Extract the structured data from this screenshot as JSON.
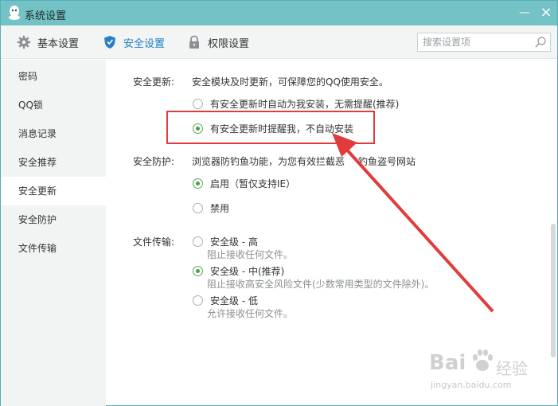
{
  "window": {
    "title": "系统设置",
    "minimize": "—",
    "close": "×"
  },
  "toolbar": {
    "tabs": [
      {
        "label": "基本设置",
        "icon": "gear-icon"
      },
      {
        "label": "安全设置",
        "icon": "shield-icon",
        "active": true
      },
      {
        "label": "权限设置",
        "icon": "lock-icon"
      }
    ],
    "search_placeholder": "搜索设置项"
  },
  "sidebar": {
    "items": [
      {
        "label": "密码"
      },
      {
        "label": "QQ锁"
      },
      {
        "label": "消息记录"
      },
      {
        "label": "安全推荐"
      },
      {
        "label": "安全更新",
        "active": true
      },
      {
        "label": "安全防护"
      },
      {
        "label": "文件传输"
      }
    ]
  },
  "content": {
    "update": {
      "label": "安全更新:",
      "desc": "安全模块及时更新，可保障您的QQ使用安全。",
      "options": [
        {
          "label": "有安全更新时自动为我安装，无需提醒(推荐)",
          "checked": false
        },
        {
          "label": "有安全更新时提醒我，不自动安装",
          "checked": true
        }
      ]
    },
    "protect": {
      "label": "安全防护:",
      "desc": "浏览器防钓鱼功能，为您有效拦截恶",
      "desc_tail": "钓鱼盗号网站",
      "options": [
        {
          "label": "启用（暂仅支持IE）",
          "checked": true
        },
        {
          "label": "禁用",
          "checked": false
        }
      ]
    },
    "transfer": {
      "label": "文件传输:",
      "options": [
        {
          "label": "安全级 - 高",
          "sub": "阻止接收任何文件。",
          "checked": false
        },
        {
          "label": "安全级 - 中(推荐)",
          "sub": "阻止接收高安全风险文件(少数常用类型的文件除外)。",
          "checked": true
        },
        {
          "label": "安全级 - 低",
          "sub": "允许接收任何文件。",
          "checked": false
        }
      ]
    }
  },
  "watermark": {
    "brand": "Bai",
    "brand2": "经验",
    "url": "jingyan.baidu.com"
  },
  "colors": {
    "titlebar": "#72c2c6",
    "accent": "#1d7dc2",
    "highlight": "#e23b3b",
    "radio_checked": "#3fa43f"
  }
}
